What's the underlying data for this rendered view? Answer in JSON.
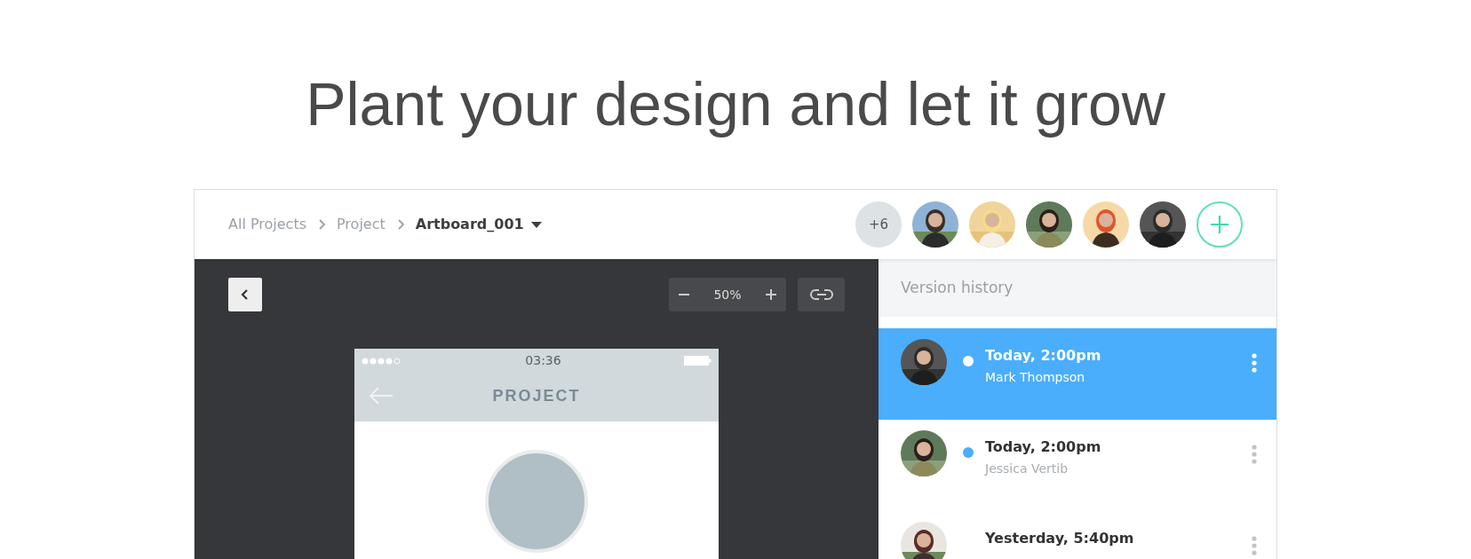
{
  "heading": "Plant your design and let it grow",
  "breadcrumb": [
    {
      "label": "All Projects",
      "current": false
    },
    {
      "label": "Project",
      "current": false
    },
    {
      "label": "Artboard_001",
      "current": true
    }
  ],
  "collaborators": {
    "more": "+6"
  },
  "canvas": {
    "zoom": "50%",
    "phone": {
      "time": "03:36",
      "title": "PROJECT"
    }
  },
  "versions": {
    "title": "Version history",
    "items": [
      {
        "time": "Today, 2:00pm",
        "author": "Mark Thompson",
        "selected": true,
        "color": "#ffffff"
      },
      {
        "time": "Today, 2:00pm",
        "author": "Jessica Vertib",
        "selected": false,
        "color": "#4aaefc"
      },
      {
        "time": "Yesterday, 5:40pm",
        "selected": false
      }
    ]
  }
}
